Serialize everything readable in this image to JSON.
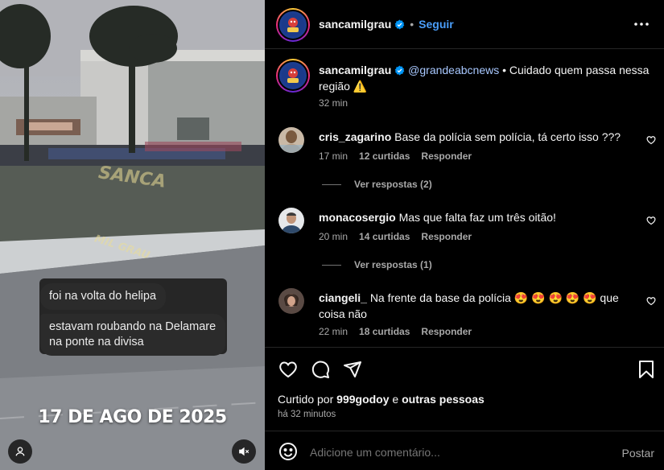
{
  "media": {
    "chat_message_1": "foi na volta do helipa",
    "chat_message_2": "estavam roubando na Delamare na ponte na divisa",
    "date_overlay": "17 DE AGO DE 2025",
    "watermark_1": "SANCA",
    "watermark_2": "MIL GRAU",
    "user_tag_icon": "person-icon",
    "mute_icon": "speaker-muted-icon"
  },
  "header": {
    "username": "sancamilgrau",
    "separator": "•",
    "follow_label": "Seguir",
    "more_icon": "more-options-icon"
  },
  "caption": {
    "username": "sancamilgrau",
    "mention": "@grandeabcnews",
    "text": " • Cuidado quem passa nessa região ⚠️",
    "time": "32 min"
  },
  "comments": [
    {
      "username": "cris_zagarino",
      "text": "Base da polícia sem polícia, tá certo isso ???",
      "time": "17 min",
      "likes": "12 curtidas",
      "reply": "Responder",
      "view_replies": "Ver respostas (2)"
    },
    {
      "username": "monacosergio",
      "text": "Mas que falta faz um três oitão!",
      "time": "20 min",
      "likes": "14 curtidas",
      "reply": "Responder",
      "view_replies": "Ver respostas (1)"
    },
    {
      "username": "ciangeli_",
      "text": "Na frente da base da polícia 😍 😍 😍 😍 😍  que coisa não",
      "time": "22 min",
      "likes": "18 curtidas",
      "reply": "Responder"
    }
  ],
  "actions": {
    "liked_prefix": "Curtido por ",
    "liked_user": "999godoy",
    "liked_mid": " e ",
    "liked_others": "outras pessoas",
    "post_time": "há 32 minutos"
  },
  "comment_box": {
    "placeholder": "Adicione um comentário...",
    "post_label": "Postar"
  },
  "colors": {
    "background": "#000000",
    "link_blue": "#4a9df8",
    "secondary_text": "#a8a8a8",
    "divider": "#262626"
  }
}
